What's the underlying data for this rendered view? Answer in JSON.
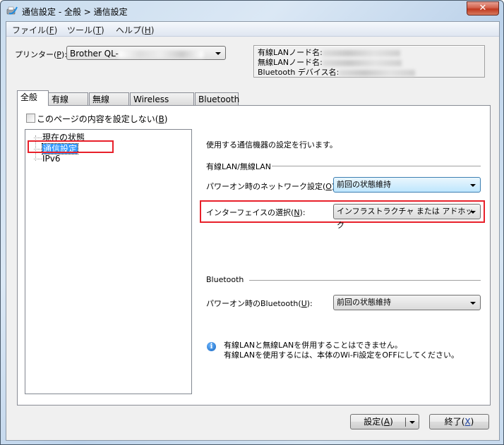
{
  "window": {
    "title": "通信設定 - 全般 > 通信設定",
    "icon": "printer-app-icon",
    "close_label": "x"
  },
  "menu": [
    {
      "label": "ファイル(",
      "key": "F",
      "end": ")"
    },
    {
      "label": "ツール(",
      "key": "T",
      "end": ")"
    },
    {
      "label": "ヘルプ(",
      "key": "H",
      "end": ")"
    }
  ],
  "printer": {
    "label_pre": "プリンター(",
    "label_key": "P",
    "label_post": "):",
    "value": "Brother QL-"
  },
  "node_info": {
    "wired": "有線LANノード名:",
    "wireless": "無線LANノード名:",
    "bluetooth": "Bluetooth デバイス名:"
  },
  "tabs": [
    {
      "label": "全般",
      "active": true
    },
    {
      "label": "有線LAN",
      "active": false
    },
    {
      "label": "無線LAN",
      "active": false
    },
    {
      "label": "Wireless Direct",
      "active": false
    },
    {
      "label": "Bluetooth",
      "active": false
    }
  ],
  "page_checkbox": {
    "label_pre": "このページの内容を設定しない(",
    "key": "B",
    "label_post": ")",
    "checked": false
  },
  "tree": [
    {
      "label": "現在の状態",
      "selected": false
    },
    {
      "label": "通信設定",
      "selected": true
    },
    {
      "label": "IPv6",
      "selected": false
    }
  ],
  "main": {
    "description": "使用する通信機器の設定を行います。",
    "lan_group": "有線LAN/無線LAN",
    "network_power_on": {
      "label_pre": "パワーオン時のネットワーク設定(",
      "key": "O",
      "label_post": "):",
      "value": "前回の状態維持"
    },
    "interface": {
      "label_pre": "インターフェイスの選択(",
      "key": "N",
      "label_post": "):",
      "value": "インフラストラクチャ または アドホック"
    },
    "bt_group": "Bluetooth",
    "bt_power_on": {
      "label_pre": "パワーオン時のBluetooth(",
      "key": "U",
      "label_post": "):",
      "value": "前回の状態維持"
    },
    "note_line1": "有線LANと無線LANを併用することはできません。",
    "note_line2": "有線LANを使用するには、本体のWi-Fi設定をOFFにしてください。"
  },
  "buttons": {
    "apply_pre": "設定(",
    "apply_key": "A",
    "apply_post": ")",
    "exit_pre": "終了(",
    "exit_key": "X",
    "exit_post": ")"
  },
  "colors": {
    "highlight_border": "#e8202a",
    "selection": "#3399ff"
  }
}
